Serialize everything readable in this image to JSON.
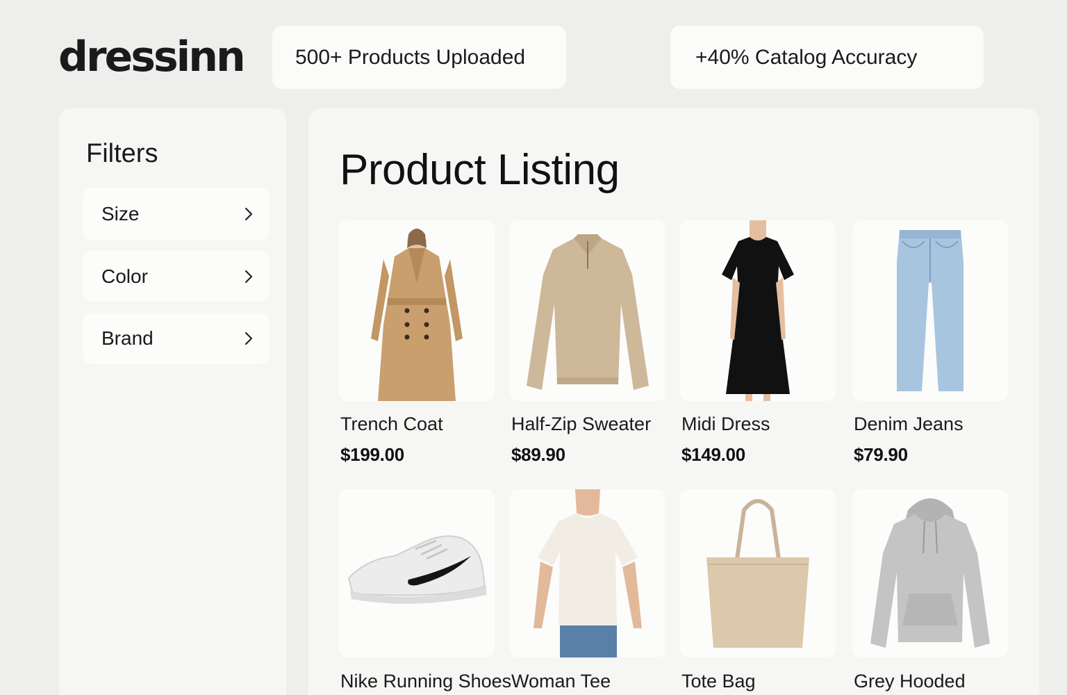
{
  "brand": {
    "logo_text": "dressinn"
  },
  "stats": [
    {
      "label": "500+ Products Uploaded"
    },
    {
      "label": "+40% Catalog Accuracy"
    }
  ],
  "filters": {
    "title": "Filters",
    "items": [
      {
        "label": "Size",
        "icon": "chevron-right-icon"
      },
      {
        "label": "Color",
        "icon": "chevron-right-icon"
      },
      {
        "label": "Brand",
        "icon": "chevron-right-icon"
      }
    ]
  },
  "listing": {
    "title": "Product Listing",
    "products": [
      {
        "name": "Trench Coat",
        "price": "$199.00",
        "image": "trench-coat-image"
      },
      {
        "name": "Half-Zip Sweater",
        "price": "$89.90",
        "image": "half-zip-sweater-image"
      },
      {
        "name": "Midi Dress",
        "price": "$149.00",
        "image": "midi-dress-image"
      },
      {
        "name": "Denim Jeans",
        "price": "$79.90",
        "image": "denim-jeans-image"
      },
      {
        "name": "Nike Running Shoes",
        "price": "",
        "image": "running-shoes-image"
      },
      {
        "name": "Woman Tee",
        "price": "",
        "image": "woman-tee-image"
      },
      {
        "name": "Tote Bag",
        "price": "",
        "image": "tote-bag-image"
      },
      {
        "name": "Grey Hooded",
        "price": "",
        "image": "grey-hoodie-image"
      }
    ]
  },
  "colors": {
    "background": "#eeeeed",
    "panel": "#f6f6f5",
    "card": "#fcfcfb",
    "text": "#141414"
  }
}
